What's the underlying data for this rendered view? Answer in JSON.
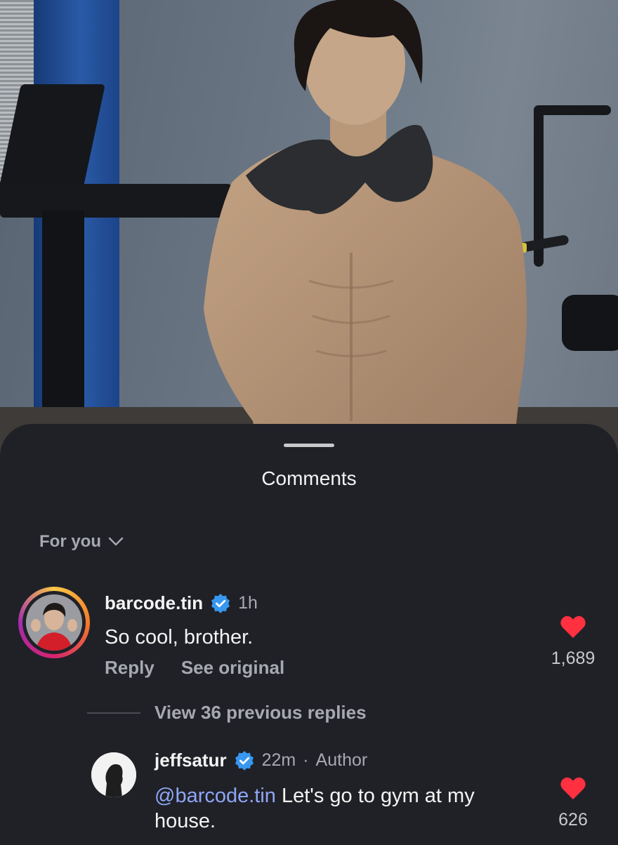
{
  "sheet": {
    "title": "Comments",
    "filter_label": "For you"
  },
  "comments": [
    {
      "username": "barcode.tin",
      "verified": true,
      "time": "1h",
      "text": "So cool, brother.",
      "reply_label": "Reply",
      "see_original_label": "See original",
      "likes": "1,689"
    }
  ],
  "thread": {
    "view_replies_label": "View 36 previous replies"
  },
  "replies": [
    {
      "username": "jeffsatur",
      "verified": true,
      "time": "22m",
      "separator": "·",
      "role": "Author",
      "mention": "@barcode.tin",
      "text_line1": " Let's go to gym at my",
      "text_line2": "house.",
      "likes": "626"
    }
  ],
  "colors": {
    "sheet_bg": "#202127",
    "like_red": "#ff3040",
    "verified_blue": "#3897f0",
    "mention_blue": "#8ea6f5",
    "muted_text": "#a7a9b1"
  },
  "icons": {
    "dropdown": "chevron-down-icon",
    "verified": "verified-badge-icon",
    "like": "heart-icon"
  }
}
